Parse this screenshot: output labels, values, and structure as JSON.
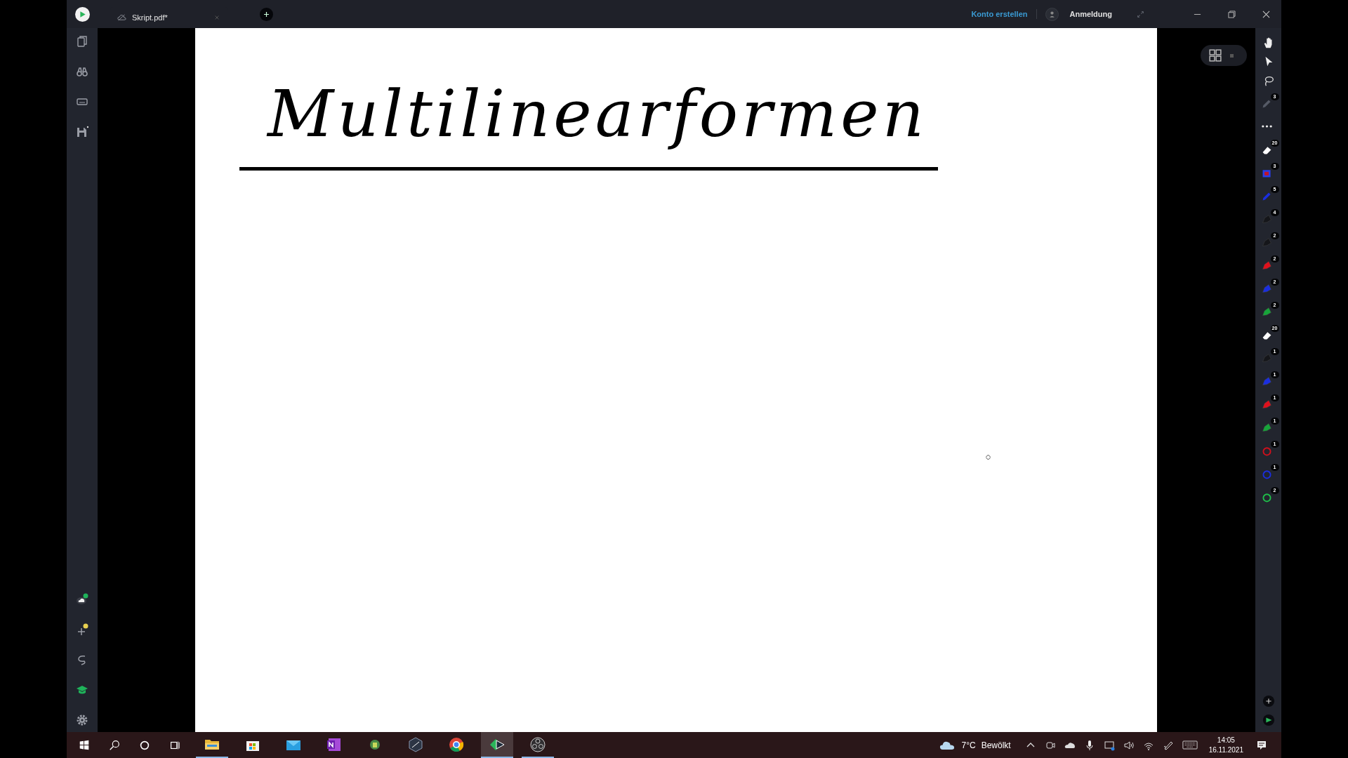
{
  "app_bar": {
    "tab": {
      "title": "Skript.pdf*"
    },
    "create_account": "Konto erstellen",
    "sign_in": "Anmeldung"
  },
  "page": {
    "heading": "Multilinearformen"
  },
  "tools": [
    {
      "kind": "pen",
      "badge": "3",
      "color": "#555a66"
    },
    {
      "kind": "more"
    },
    {
      "kind": "eraser",
      "badge": "20",
      "color": "#ffffff"
    },
    {
      "kind": "shape",
      "badge": "3",
      "color": "#2a3ee8"
    },
    {
      "kind": "pen",
      "badge": "5",
      "color": "#1a2ee0"
    },
    {
      "kind": "marker",
      "badge": "4",
      "color": "#15161a"
    },
    {
      "kind": "marker",
      "badge": "2",
      "color": "#15161a"
    },
    {
      "kind": "marker",
      "badge": "2",
      "color": "#e0101c"
    },
    {
      "kind": "marker",
      "badge": "2",
      "color": "#1a2ee0"
    },
    {
      "kind": "marker",
      "badge": "2",
      "color": "#17a43a"
    },
    {
      "kind": "eraser",
      "badge": "20",
      "color": "#ffffff"
    },
    {
      "kind": "marker",
      "badge": "1",
      "color": "#15161a"
    },
    {
      "kind": "marker",
      "badge": "1",
      "color": "#1a2ee0"
    },
    {
      "kind": "marker",
      "badge": "1",
      "color": "#e0101c"
    },
    {
      "kind": "marker",
      "badge": "1",
      "color": "#17a43a"
    },
    {
      "kind": "ring",
      "badge": "1",
      "color": "#d0101c"
    },
    {
      "kind": "ring",
      "badge": "1",
      "color": "#1a2ee0"
    },
    {
      "kind": "ring",
      "badge": "2",
      "color": "#1fbf4a"
    }
  ],
  "taskbar": {
    "apps": [
      {
        "kind": "explorer",
        "active": false,
        "running": true
      },
      {
        "kind": "store",
        "active": false,
        "running": false
      },
      {
        "kind": "mail",
        "active": false,
        "running": false
      },
      {
        "kind": "onenote",
        "active": false,
        "running": false
      },
      {
        "kind": "robot",
        "active": false,
        "running": false
      },
      {
        "kind": "hexagon",
        "active": false,
        "running": false
      },
      {
        "kind": "chrome",
        "active": false,
        "running": false
      },
      {
        "kind": "notes",
        "active": true,
        "running": true
      },
      {
        "kind": "obs",
        "active": false,
        "running": true
      }
    ],
    "temperature": "7°C",
    "weather": "Bewölkt",
    "time": "14:05",
    "date": "16.11.2021"
  }
}
